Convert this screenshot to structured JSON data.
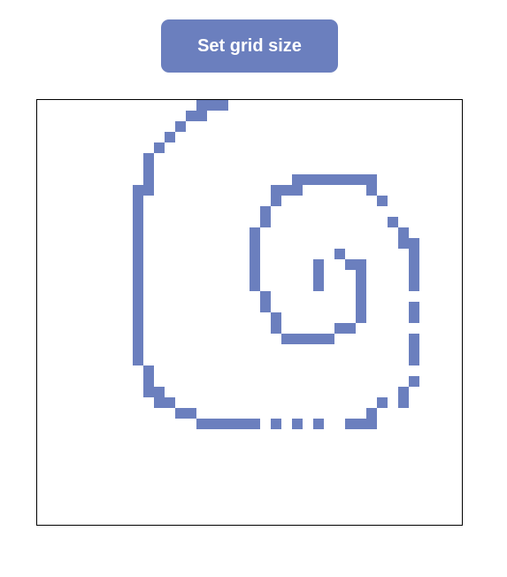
{
  "toolbar": {
    "set_grid_button_label": "Set grid size"
  },
  "grid": {
    "columns": 40,
    "rows": 40,
    "fill_color": "#6b7fbe",
    "background_color": "#ffffff",
    "filled_cells": [
      [
        15,
        0
      ],
      [
        16,
        0
      ],
      [
        17,
        0
      ],
      [
        14,
        1
      ],
      [
        15,
        1
      ],
      [
        13,
        2
      ],
      [
        12,
        3
      ],
      [
        11,
        4
      ],
      [
        10,
        5
      ],
      [
        10,
        6
      ],
      [
        9,
        8
      ],
      [
        10,
        8
      ],
      [
        24,
        7
      ],
      [
        25,
        7
      ],
      [
        26,
        7
      ],
      [
        27,
        7
      ],
      [
        28,
        7
      ],
      [
        29,
        7
      ],
      [
        30,
        7
      ],
      [
        31,
        7
      ],
      [
        22,
        8
      ],
      [
        23,
        8
      ],
      [
        24,
        8
      ],
      [
        31,
        8
      ],
      [
        22,
        9
      ],
      [
        32,
        9
      ],
      [
        21,
        10
      ],
      [
        21,
        11
      ],
      [
        33,
        11
      ],
      [
        20,
        12
      ],
      [
        34,
        12
      ],
      [
        20,
        13
      ],
      [
        34,
        13
      ],
      [
        35,
        13
      ],
      [
        20,
        14
      ],
      [
        35,
        14
      ],
      [
        28,
        14
      ],
      [
        20,
        15
      ],
      [
        26,
        15
      ],
      [
        29,
        15
      ],
      [
        30,
        15
      ],
      [
        35,
        15
      ],
      [
        20,
        16
      ],
      [
        26,
        16
      ],
      [
        30,
        16
      ],
      [
        35,
        16
      ],
      [
        20,
        17
      ],
      [
        26,
        17
      ],
      [
        30,
        17
      ],
      [
        35,
        17
      ],
      [
        21,
        18
      ],
      [
        30,
        18
      ],
      [
        21,
        19
      ],
      [
        30,
        19
      ],
      [
        35,
        19
      ],
      [
        22,
        20
      ],
      [
        30,
        20
      ],
      [
        35,
        20
      ],
      [
        22,
        21
      ],
      [
        28,
        21
      ],
      [
        29,
        21
      ],
      [
        23,
        22
      ],
      [
        24,
        22
      ],
      [
        25,
        22
      ],
      [
        26,
        22
      ],
      [
        27,
        22
      ],
      [
        35,
        22
      ],
      [
        35,
        23
      ],
      [
        35,
        24
      ],
      [
        35,
        26
      ],
      [
        34,
        27
      ],
      [
        34,
        28
      ],
      [
        32,
        28
      ],
      [
        31,
        29
      ],
      [
        31,
        30
      ],
      [
        30,
        30
      ],
      [
        29,
        30
      ],
      [
        26,
        30
      ],
      [
        24,
        30
      ],
      [
        22,
        30
      ],
      [
        20,
        30
      ],
      [
        19,
        30
      ],
      [
        15,
        30
      ],
      [
        16,
        30
      ],
      [
        17,
        30
      ],
      [
        18,
        30
      ],
      [
        13,
        29
      ],
      [
        14,
        29
      ],
      [
        11,
        28
      ],
      [
        12,
        28
      ],
      [
        10,
        27
      ],
      [
        11,
        27
      ],
      [
        10,
        26
      ],
      [
        10,
        25
      ],
      [
        9,
        9
      ],
      [
        9,
        10
      ],
      [
        9,
        11
      ],
      [
        9,
        12
      ],
      [
        9,
        13
      ],
      [
        9,
        14
      ],
      [
        9,
        15
      ],
      [
        9,
        16
      ],
      [
        9,
        17
      ],
      [
        9,
        18
      ],
      [
        9,
        19
      ],
      [
        9,
        20
      ],
      [
        9,
        21
      ],
      [
        9,
        22
      ],
      [
        9,
        23
      ],
      [
        9,
        24
      ],
      [
        10,
        7
      ]
    ]
  }
}
